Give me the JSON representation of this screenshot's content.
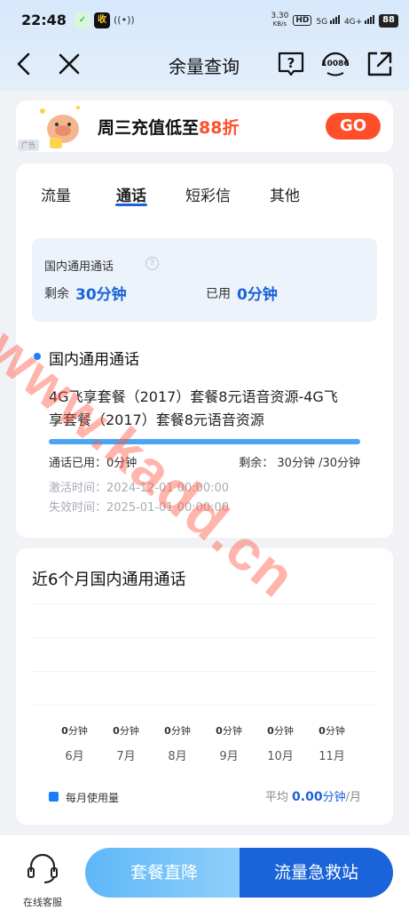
{
  "status_bar": {
    "time": "22:48",
    "net_speed": "3.30",
    "net_unit": "KB/s",
    "hd_label": "HD",
    "sim1": "5G",
    "sim2": "4G+",
    "battery": "88"
  },
  "header": {
    "title": "余量查询",
    "hotline": "10086"
  },
  "ad": {
    "text_prefix": "周三充值低至",
    "text_highlight": "88折",
    "tag": "广告",
    "go_label": "GO"
  },
  "tabs": [
    {
      "label": "流量",
      "active": false
    },
    {
      "label": "通话",
      "active": true
    },
    {
      "label": "短彩信",
      "active": false
    },
    {
      "label": "其他",
      "active": false
    }
  ],
  "summary": {
    "title": "国内通用通话",
    "remaining_label": "剩余",
    "remaining_value": "30分钟",
    "used_label": "已用",
    "used_value": "0分钟"
  },
  "detail": {
    "section_title": "国内通用通话",
    "package_name_line1": "4G飞享套餐（2017）套餐8元语音资源-4G飞",
    "package_name_line2": "享套餐（2017）套餐8元语音资源",
    "remaining_fraction": 1.0,
    "used_text": "通话已用：0分钟",
    "remaining_text": "剩余：   30分钟 /30分钟",
    "activate_text": "激活时间：2024-12-01 00:00:00",
    "expire_text": "失效时间：2025-01-01 00:00:00"
  },
  "history": {
    "title": "近6个月国内通用通话",
    "months": [
      {
        "num": "0",
        "unit": "分钟",
        "label": "6月"
      },
      {
        "num": "0",
        "unit": "分钟",
        "label": "7月"
      },
      {
        "num": "0",
        "unit": "分钟",
        "label": "8月"
      },
      {
        "num": "0",
        "unit": "分钟",
        "label": "9月"
      },
      {
        "num": "0",
        "unit": "分钟",
        "label": "10月"
      },
      {
        "num": "0",
        "unit": "分钟",
        "label": "11月"
      }
    ],
    "legend": "每月使用量",
    "avg_label": "平均",
    "avg_value": "0.00",
    "avg_unit": "分钟",
    "avg_per": "/月"
  },
  "bottom": {
    "service_label": "在线客服",
    "btn_left": "套餐直降",
    "btn_right": "流量急救站"
  },
  "watermark": "www.kadd.cn",
  "colors": {
    "accent": "#1a63d8",
    "promo": "#ff4e2a",
    "header_bg": "#d6e8fb",
    "page_bg": "#f0f2f6"
  }
}
